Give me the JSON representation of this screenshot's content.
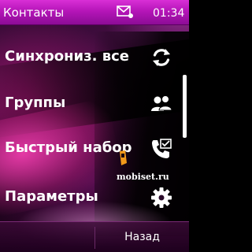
{
  "status_bar": {
    "title": "Контакты",
    "time": "01:34",
    "message_icon": "envelope-icon"
  },
  "menu": {
    "items": [
      {
        "label": "Синхрониз. все",
        "icon": "sync-icon"
      },
      {
        "label": "Группы",
        "icon": "group-icon"
      },
      {
        "label": "Быстрый набор",
        "icon": "speed-dial-icon"
      },
      {
        "label": "Параметры",
        "icon": "gear-icon"
      }
    ]
  },
  "softkeys": {
    "right_label": "Назад"
  },
  "watermark": {
    "text": "mobiset.ru"
  },
  "colors": {
    "status_bar": "#c21fc4",
    "accent": "#d92fd6",
    "text": "#ffffff"
  }
}
